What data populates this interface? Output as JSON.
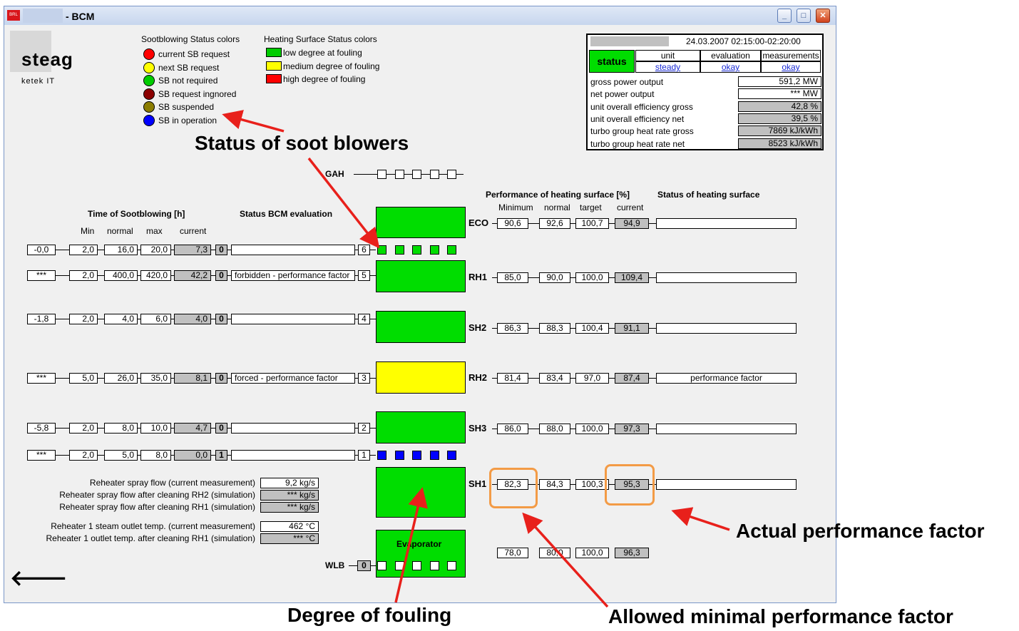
{
  "window": {
    "title": "- BCM",
    "app_icon_text": "BRL"
  },
  "logo": {
    "brand": "steag",
    "sub": "ketek IT"
  },
  "legend_sb": {
    "title": "Sootblowing Status colors",
    "items": [
      {
        "label": "current SB request",
        "color": "#ff0000"
      },
      {
        "label": "next SB request",
        "color": "#ffff00"
      },
      {
        "label": "SB not required",
        "color": "#00cc00"
      },
      {
        "label": "SB request ingnored",
        "color": "#8b0000"
      },
      {
        "label": "SB suspended",
        "color": "#8b7d00"
      },
      {
        "label": "SB in operation",
        "color": "#0000ff"
      }
    ]
  },
  "legend_hs": {
    "title": "Heating Surface Status colors",
    "items": [
      {
        "label": "low degree at fouling",
        "color": "#00cc00"
      },
      {
        "label": "medium degree of fouling",
        "color": "#ffff00"
      },
      {
        "label": "high degree of fouling",
        "color": "#ff0000"
      }
    ]
  },
  "status_panel": {
    "datetime": "24.03.2007 02:15:00-02:20:00",
    "status_label": "status",
    "headers": [
      "unit",
      "evaluation",
      "measurements"
    ],
    "values": [
      "steady",
      "okay",
      "okay"
    ],
    "rows": [
      {
        "label": "gross power output",
        "value": "591,2 MW"
      },
      {
        "label": "net power output",
        "value": "*** MW"
      },
      {
        "label": "unit overall efficiency gross",
        "value": "42,8 %"
      },
      {
        "label": "unit overall efficiency net",
        "value": "39,5 %"
      },
      {
        "label": "turbo group heat rate gross",
        "value": "7869 kJ/kWh"
      },
      {
        "label": "turbo group heat rate net",
        "value": "8523 kJ/kWh"
      }
    ]
  },
  "headers": {
    "time": "Time of Sootblowing [h]",
    "time_cols": [
      "Min",
      "normal",
      "max",
      "current"
    ],
    "bcm": "Status BCM evaluation",
    "perf": "Performance of heating surface [%]",
    "perf_cols": [
      "Minimum",
      "normal",
      "target",
      "current"
    ],
    "status_hs": "Status of heating surface",
    "gah": "GAH",
    "wlb": "WLB",
    "wlb_value": "0",
    "evaporator": "Evaporator"
  },
  "sb_rows": [
    {
      "min": "-0,0",
      "normal": "2,0",
      "max": "16,0",
      "x": "20,0",
      "current": "7,3",
      "flag": "0",
      "bcm": "",
      "num": "6"
    },
    {
      "min": "***",
      "normal": "2,0",
      "max": "400,0",
      "x": "420,0",
      "current": "42,2",
      "flag": "0",
      "bcm": "forbidden - performance factor",
      "num": "5"
    },
    {
      "min": "-1,8",
      "normal": "2,0",
      "max": "4,0",
      "x": "6,0",
      "current": "4,0",
      "flag": "0",
      "bcm": "",
      "num": "4"
    },
    {
      "min": "***",
      "normal": "5,0",
      "max": "26,0",
      "x": "35,0",
      "current": "8,1",
      "flag": "0",
      "bcm": "forced - performance factor",
      "num": "3"
    },
    {
      "min": "-5,8",
      "normal": "2,0",
      "max": "8,0",
      "x": "10,0",
      "current": "4,7",
      "flag": "0",
      "bcm": "",
      "num": "2"
    },
    {
      "min": "***",
      "normal": "2,0",
      "max": "5,0",
      "x": "8,0",
      "current": "0,0",
      "flag": "1",
      "bcm": "",
      "num": "1"
    }
  ],
  "hs_rows": [
    {
      "name": "ECO",
      "min": "90,6",
      "normal": "92,6",
      "target": "100,7",
      "current": "94,9",
      "status": ""
    },
    {
      "name": "RH1",
      "min": "85,0",
      "normal": "90,0",
      "target": "100,0",
      "current": "109,4",
      "status": ""
    },
    {
      "name": "SH2",
      "min": "86,3",
      "normal": "88,3",
      "target": "100,4",
      "current": "91,1",
      "status": ""
    },
    {
      "name": "RH2",
      "min": "81,4",
      "normal": "83,4",
      "target": "97,0",
      "current": "87,4",
      "status": "performance factor"
    },
    {
      "name": "SH3",
      "min": "86,0",
      "normal": "88,0",
      "target": "100,0",
      "current": "97,3",
      "status": ""
    },
    {
      "name": "SH1",
      "min": "82,3",
      "normal": "84,3",
      "target": "100,3",
      "current": "95,3",
      "status": ""
    },
    {
      "name": "",
      "min": "78,0",
      "normal": "80,0",
      "target": "100,0",
      "current": "96,3",
      "status": ""
    }
  ],
  "sim": [
    {
      "label": "Reheater spray flow (current measurement)",
      "value": "9,2 kg/s"
    },
    {
      "label": "Reheater spray flow after cleaning RH2 (simulation)",
      "value": "*** kg/s"
    },
    {
      "label": "Reheater spray flow after cleaning RH1 (simulation)",
      "value": "*** kg/s"
    },
    {
      "label": "Reheater 1 steam outlet temp. (current measurement)",
      "value": "462 °C"
    },
    {
      "label": "Reheater 1 outlet temp. after cleaning RH1 (simulation)",
      "value": "*** °C"
    }
  ],
  "annotations": {
    "soot": "Status of soot blowers",
    "fouling": "Degree of fouling",
    "actual": "Actual performance factor",
    "minimal": "Allowed minimal performance factor"
  },
  "colors": {
    "green": "#00dd00",
    "yellow": "#ffff00",
    "blue": "#0000ff",
    "brown": "#8b6914",
    "arrow": "#e8201b",
    "highlight": "#f39b46"
  }
}
